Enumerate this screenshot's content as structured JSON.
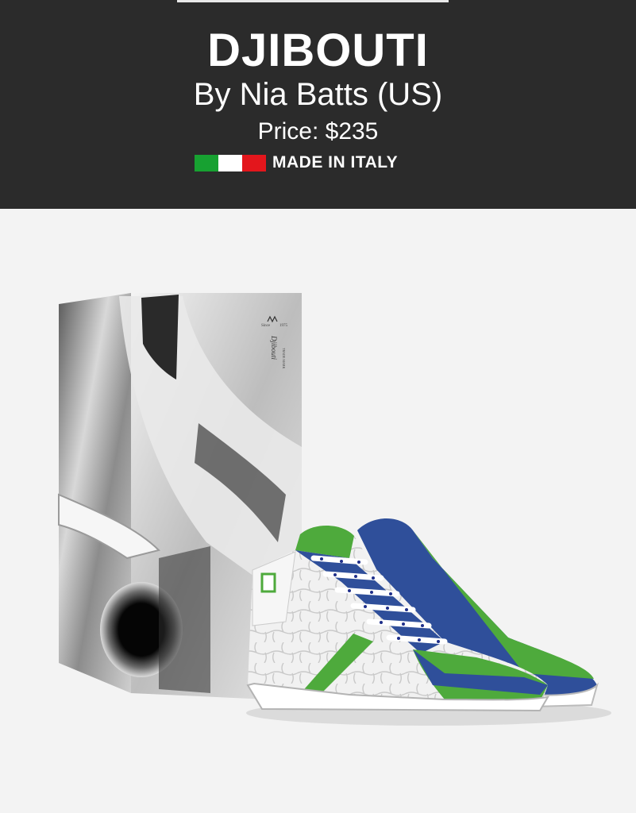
{
  "product": {
    "name": "DJIBOUTI",
    "designer": "By Nia Batts (US)",
    "price": "Price: $235",
    "origin_label": "MADE IN ITALY"
  },
  "flag": {
    "colors": [
      "#17a131",
      "#ffffff",
      "#e3161c"
    ],
    "icon": "italy-flag-icon"
  },
  "box": {
    "brand_mark": "Djibouti",
    "since_text": "Since",
    "year_text": "1975",
    "trade_mark": "TRADE MARK"
  },
  "colors": {
    "header_bg": "#2b2b2b",
    "shoe_green": "#4eaa3c",
    "shoe_blue": "#2f4f9a",
    "shoe_white": "#f1f1f1"
  }
}
